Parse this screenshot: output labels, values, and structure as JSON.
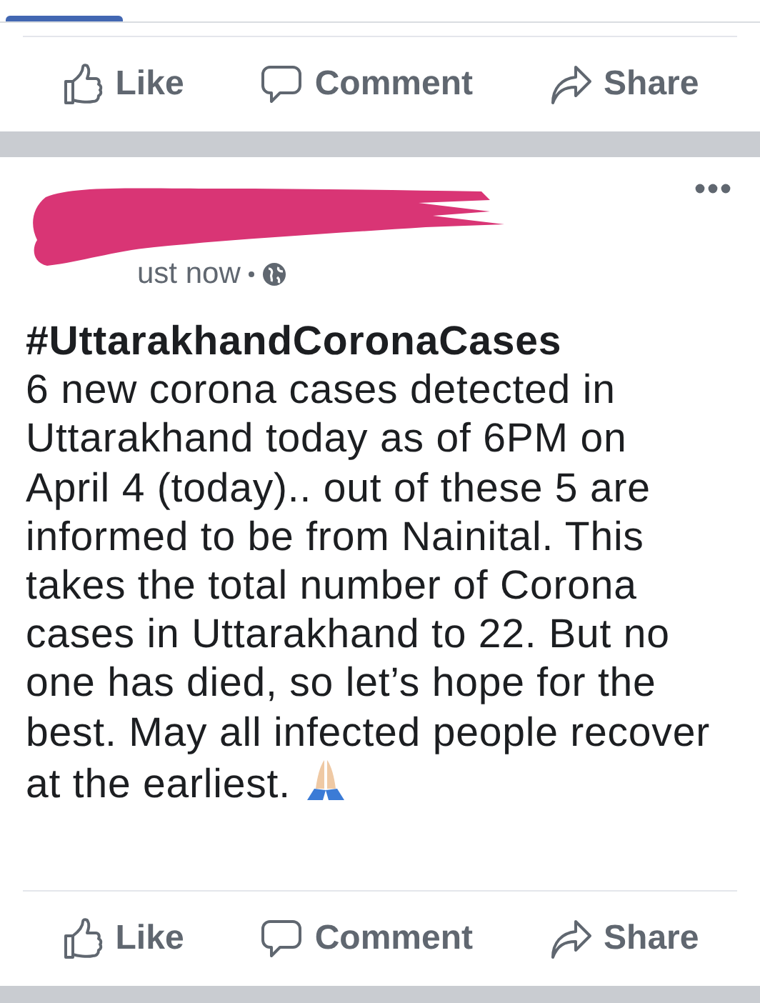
{
  "top_actions": [
    {
      "label": "Like",
      "kind": "like"
    },
    {
      "label": "Comment",
      "kind": "comment"
    },
    {
      "label": "Share",
      "kind": "share"
    }
  ],
  "post": {
    "time": "ust now",
    "hashtag": "#UttarakhandCoronaCases",
    "body_lines": [
      "6 new corona cases detected in",
      "Uttarakhand today as of 6PM on",
      "April 4 (today).. out of these 5 are",
      "informed to be from Nainital. This",
      "takes the total number of Corona",
      "cases in Uttarakhand to 22. But no",
      "one has died, so let’s hope for the",
      "best. May all infected people recover",
      "at the earliest."
    ],
    "actions": [
      {
        "label": "Like",
        "kind": "like"
      },
      {
        "label": "Comment",
        "kind": "comment"
      },
      {
        "label": "Share",
        "kind": "share"
      }
    ]
  }
}
